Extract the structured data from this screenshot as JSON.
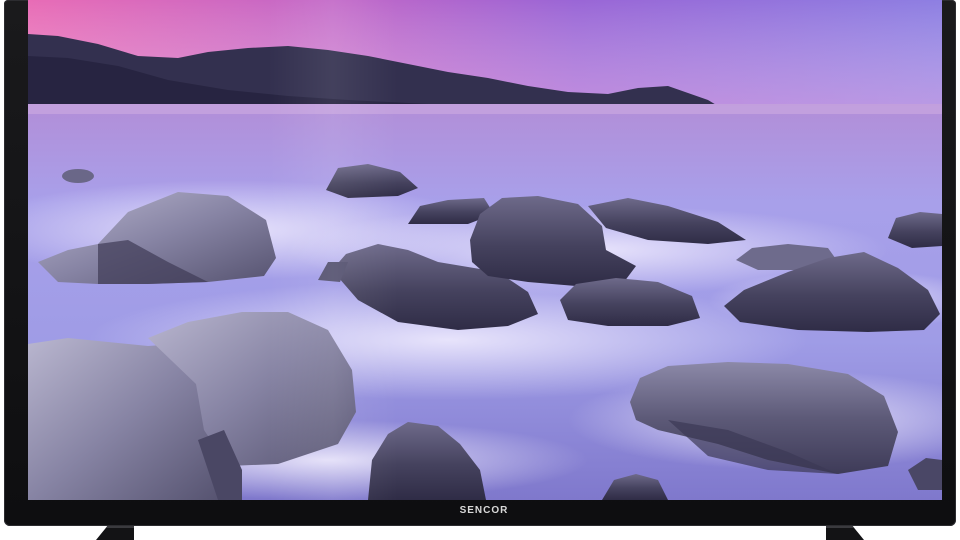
{
  "tv": {
    "brand_label": "SENCOR"
  },
  "colors": {
    "bezel": "#111113",
    "sky_top": "#e06cb8",
    "sky_mid": "#9a6ad8",
    "sky_right": "#8a7ae0",
    "water": "#b4a6ec",
    "mist": "#e8e2fa",
    "rock": "#5a5872",
    "mountain": "#2e2c4e"
  },
  "icons": {
    "stand_left": "tv-stand-foot",
    "stand_right": "tv-stand-foot"
  }
}
